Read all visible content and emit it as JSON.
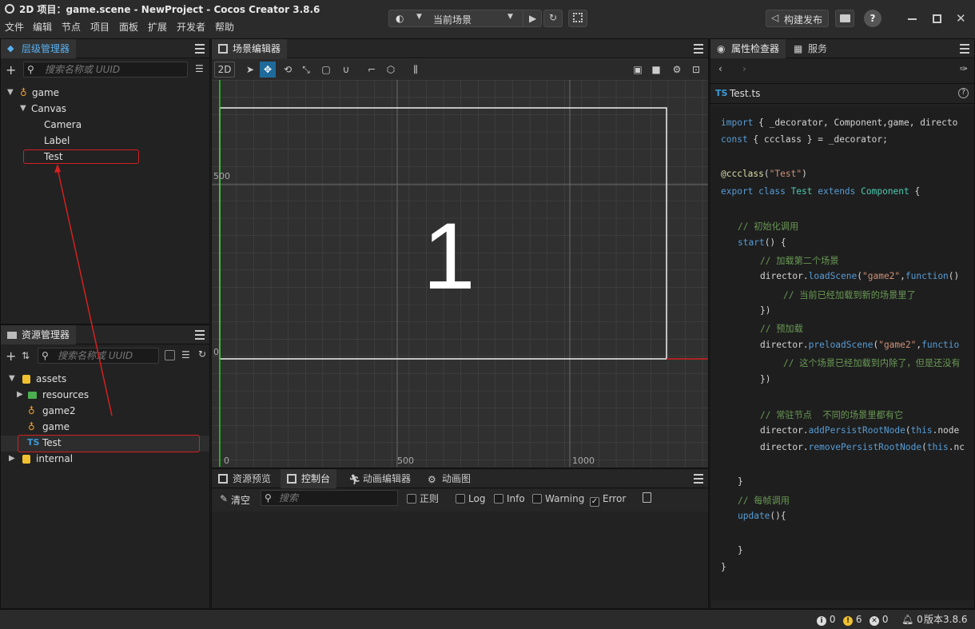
{
  "window": {
    "title": "2D 项目：game.scene - NewProject - Cocos Creator 3.8.6",
    "menu": [
      "文件",
      "编辑",
      "节点",
      "项目",
      "面板",
      "扩展",
      "开发者",
      "帮助"
    ],
    "scene_select": "当前场景",
    "build_button": "构建发布"
  },
  "hierarchy": {
    "tab": "层级管理器",
    "search_placeholder": "搜索名称或 UUID",
    "nodes": [
      "game",
      "Canvas",
      "Camera",
      "Label",
      "Test"
    ]
  },
  "assets": {
    "tab": "资源管理器",
    "search_placeholder": "搜索名称或 UUID",
    "items": [
      "assets",
      "resources",
      "game2",
      "game",
      "Test",
      "internal"
    ],
    "ts_badge": "TS"
  },
  "scene": {
    "tab": "场景编辑器",
    "mode_2d": "2D",
    "big_label": "1",
    "axis_labels": {
      "y500": "500",
      "y0": "0",
      "x0": "0",
      "x500": "500",
      "x1000": "1000"
    }
  },
  "console": {
    "tabs": [
      "资源预览",
      "控制台",
      "动画编辑器",
      "动画图"
    ],
    "clear": "清空",
    "search_placeholder": "搜索",
    "filters": [
      {
        "label": "正则",
        "checked": false
      },
      {
        "label": "Log",
        "checked": false
      },
      {
        "label": "Info",
        "checked": false
      },
      {
        "label": "Warning",
        "checked": false
      },
      {
        "label": "Error",
        "checked": true
      }
    ]
  },
  "inspector": {
    "tabs": [
      "属性检查器",
      "服务"
    ],
    "file": "Test.ts",
    "ts_badge": "TS"
  },
  "code": {
    "l1a": "import",
    "l1b": " { _decorator, Component,game, directo",
    "l2a": "const",
    "l2b": " { ccclass } = _decorator;",
    "l3a": "@ccclass",
    "l3b": "(",
    "l3c": "\"Test\"",
    "l3d": ")",
    "l4a": "export class",
    "l4b": " Test ",
    "l4c": "extends",
    "l4d": " Component",
    "l4e": " {",
    "l5": "// 初始化调用",
    "l6a": "start",
    "l6b": "() {",
    "l7": "// 加载第二个场景",
    "l8a": "director.",
    "l8b": "loadScene",
    "l8c": "(",
    "l8d": "\"game2\"",
    "l8e": ",",
    "l8f": "function",
    "l8g": "()",
    "l9": "// 当前已经加载到新的场景里了",
    "l10": "})",
    "l11": "// 预加载",
    "l12a": "director.",
    "l12b": "preloadScene",
    "l12c": "(",
    "l12d": "\"game2\"",
    "l12e": ",",
    "l12f": "functio",
    "l13": "// 这个场景已经加载到内除了，但是还没有",
    "l14": "})",
    "l15": "// 常驻节点  不同的场景里都有它",
    "l16a": "director.",
    "l16b": "addPersistRootNode",
    "l16c": "(",
    "l16d": "this",
    "l16e": ".node",
    "l17a": "director.",
    "l17b": "removePersistRootNode",
    "l17c": "(",
    "l17d": "this",
    "l17e": ".nc",
    "l18": "}",
    "l19": "// 每帧调用",
    "l20a": "update",
    "l20b": "(){",
    "l21": "}",
    "l22": "}"
  },
  "statusbar": {
    "info": "0",
    "warn": "6",
    "error": "0",
    "notify": "0",
    "version": "版本3.8.6"
  },
  "colors": {
    "accent": "#3d9ad8",
    "annotation": "#d42020",
    "warn": "#f0c030"
  }
}
